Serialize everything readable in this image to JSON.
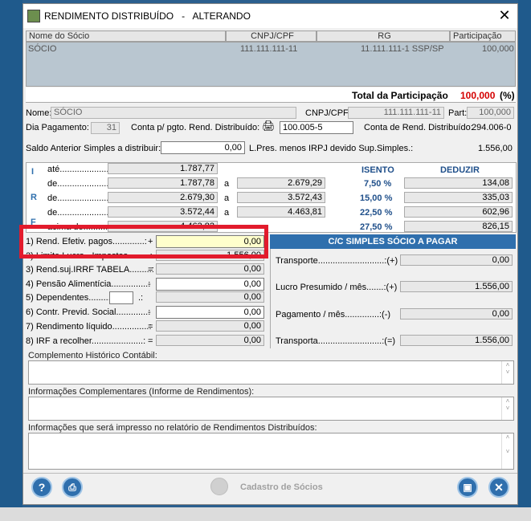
{
  "window": {
    "title": "RENDIMENTO DISTRIBUÍDO   -   ALTERANDO",
    "close": "✕"
  },
  "grid": {
    "headers": [
      "Nome do Sócio",
      "CNPJ/CPF",
      "RG",
      "Participação"
    ],
    "row": [
      "SÓCIO",
      "111.111.111-11",
      "11.111.111-1 SSP/SP",
      "100,000"
    ]
  },
  "total": {
    "label": "Total da Participação",
    "value": "100,000",
    "unit": "(%)"
  },
  "form": {
    "nome_label": "Nome:",
    "nome_value": "SÓCIO",
    "cnpj_label": "CNPJ/CPF:",
    "cnpj_value": "111.111.111-11",
    "part_label": "Part:",
    "part_value": "100,000",
    "dia_label": "Dia Pagamento:",
    "dia_value": "31",
    "conta_label": "Conta p/ pgto. Rend. Distribuído:",
    "conta_value": "100.005-5",
    "conta_rend_label": "Conta de Rend. Distribuído:",
    "conta_rend_value": "294.006-0",
    "saldo_label": "Saldo Anterior Simples a distribuir:",
    "saldo_value": "0,00",
    "lpres_label": "L.Pres. menos IRPJ devido Sup.Simples.:",
    "lpres_value": "1.556,00"
  },
  "irrf": {
    "side_letters": [
      "I",
      "R",
      "F"
    ],
    "isento_label": "ISENTO",
    "deduzir_label": "DEDUZIR",
    "rows": [
      {
        "label": "até.......................:",
        "from": "1.787,77",
        "a": "",
        "to": "",
        "rate": "ISENTO",
        "ded": ""
      },
      {
        "label": "de.........................:",
        "from": "1.787,78",
        "a": "a",
        "to": "2.679,29",
        "rate": "7,50 %",
        "ded": "134,08"
      },
      {
        "label": "de.........................:",
        "from": "2.679,30",
        "a": "a",
        "to": "3.572,43",
        "rate": "15,00 %",
        "ded": "335,03"
      },
      {
        "label": "de.........................:",
        "from": "3.572,44",
        "a": "a",
        "to": "4.463,81",
        "rate": "22,50 %",
        "ded": "602,96"
      },
      {
        "label": "acima de..................:",
        "from": "4.463,82",
        "a": "",
        "to": "",
        "rate": "27,50 %",
        "ded": "826,15"
      }
    ]
  },
  "calc": [
    {
      "label": "1) Rend. Efetiv. pagos.............:",
      "op": "+",
      "value": "0,00"
    },
    {
      "label": "2) Limite.Lucro - Impostos.........:",
      "op": "",
      "value": "1.556,00"
    },
    {
      "label": "3) Rend.suj.IRRF TABELA.........:",
      "op": "=",
      "value": "0,00"
    },
    {
      "label": "4) Pensão Alimentícia...............:",
      "op": "-",
      "value": "0,00"
    },
    {
      "label": "5) Dependentes.........",
      "op": ".:",
      "value": "0,00"
    },
    {
      "label": "6) Contr. Previd. Social.............:",
      "op": "-",
      "value": "0,00"
    },
    {
      "label": "7) Rendimento líquido...............:",
      "op": "=",
      "value": "0,00"
    },
    {
      "label": "8) IRF a recolher.....................:",
      "op": "=",
      "value": "0,00"
    }
  ],
  "cc": {
    "header": "C/C SIMPLES SÓCIO A PAGAR",
    "rows": [
      {
        "label": "Transporte...........................:(+)",
        "value": "0,00"
      },
      {
        "label": "Lucro Presumido / mês.......:(+)",
        "value": "1.556,00"
      },
      {
        "label": "Pagamento / mês..............:(-)",
        "value": "0,00"
      },
      {
        "label": "Transporta..........................:(=)",
        "value": "1.556,00"
      }
    ]
  },
  "memos": {
    "historico": "Complemento Histórico Contábil:",
    "info_comp": "Informações Complementares (Informe de Rendimentos):",
    "info_rel": "Informações que será impresso no relatório de Rendimentos Distribuídos:"
  },
  "footer": {
    "cadastro": "Cadastro de Sócios",
    "help": "?",
    "close": "✕"
  },
  "colors": {
    "accent_blue": "#2f6fad",
    "highlight_red": "#e21b2c",
    "total_red": "#d40000",
    "input_yellow": "#ffffcc"
  }
}
